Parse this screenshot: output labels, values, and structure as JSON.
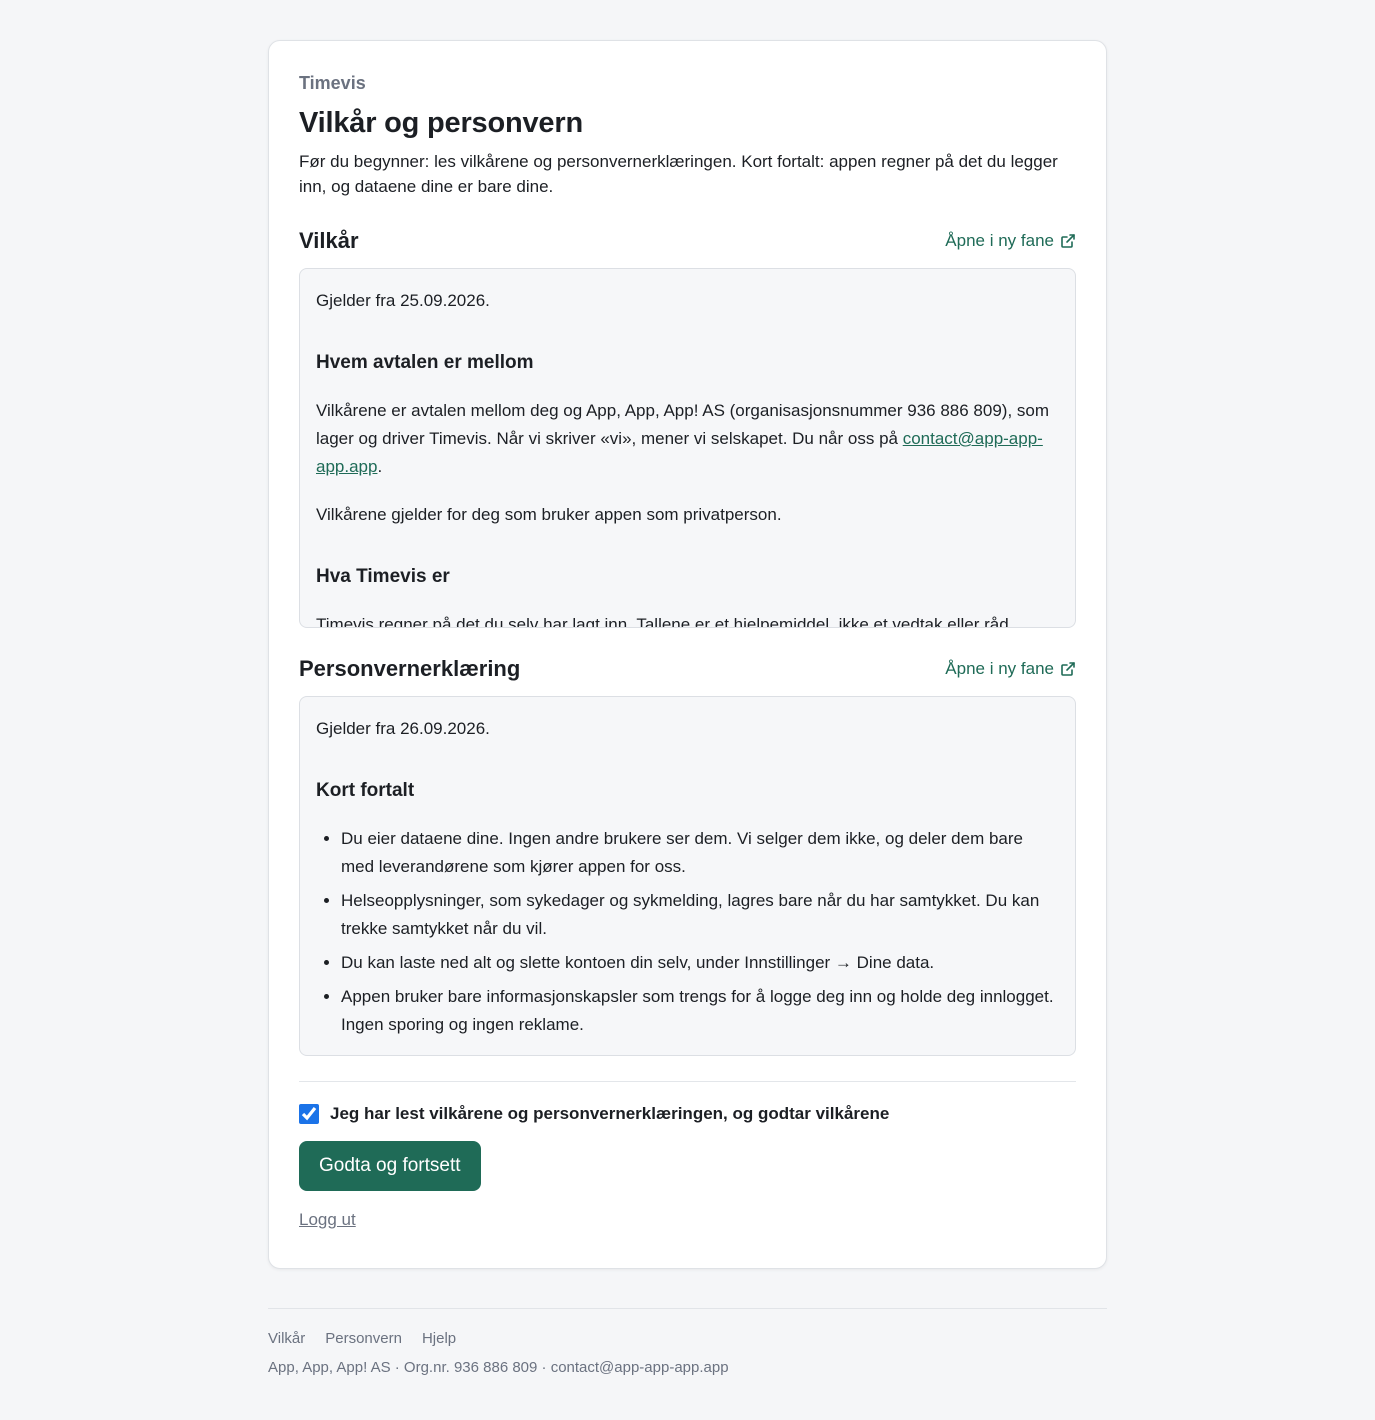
{
  "brand": "Timevis",
  "title": "Vilkår og personvern",
  "intro": "Før du begynner: les vilkårene og personvernerklæringen. Kort fortalt: appen regner på det du legger inn, og dataene dine er bare dine.",
  "terms": {
    "heading": "Vilkår",
    "open_link": "Åpne i ny fane",
    "effective": "Gjelder fra 25.09.2026.",
    "section1_heading": "Hvem avtalen er mellom",
    "section1_p1_text": "Vilkårene er avtalen mellom deg og App, App, App! AS (organisasjonsnummer 936 886 809), som lager og driver Timevis. Når vi skriver «vi», mener vi selskapet. Du når oss på ",
    "contact_email": "contact@app-app-app.app",
    "section1_p1_end": ".",
    "section1_p2": "Vilkårene gjelder for deg som bruker appen som privatperson.",
    "section2_heading": "Hva Timevis er",
    "section2_p1": "Timevis regner på det du selv har lagt inn. Tallene er et hjelpemiddel, ikke et vedtak eller råd"
  },
  "privacy": {
    "heading": "Personvernerklæring",
    "open_link": "Åpne i ny fane",
    "effective": "Gjelder fra 26.09.2026.",
    "summary_heading": "Kort fortalt",
    "items": [
      "Du eier dataene dine. Ingen andre brukere ser dem. Vi selger dem ikke, og deler dem bare med leverandørene som kjører appen for oss.",
      "Helseopplysninger, som sykedager og sykmelding, lagres bare når du har samtykket. Du kan trekke samtykket når du vil.",
      "Du kan laste ned alt og slette kontoen din selv, under Innstillinger → Dine data.",
      "Appen bruker bare informasjonskapsler som trengs for å logge deg inn og holde deg innlogget. Ingen sporing og ingen reklame."
    ]
  },
  "consent_label": "Jeg har lest vilkårene og personvernerklæringen, og godtar vilkårene",
  "consent_checked": true,
  "accept_button": "Godta og fortsett",
  "logout_link": "Logg ut",
  "footer": {
    "links": [
      "Vilkår",
      "Personvern",
      "Hjelp"
    ],
    "meta": "App, App, App! AS · Org.nr. 936 886 809 · contact@app-app-app.app"
  },
  "colors": {
    "accent": "#1f6b57",
    "background": "#f5f6f8",
    "checkbox": "#1b73e8"
  }
}
